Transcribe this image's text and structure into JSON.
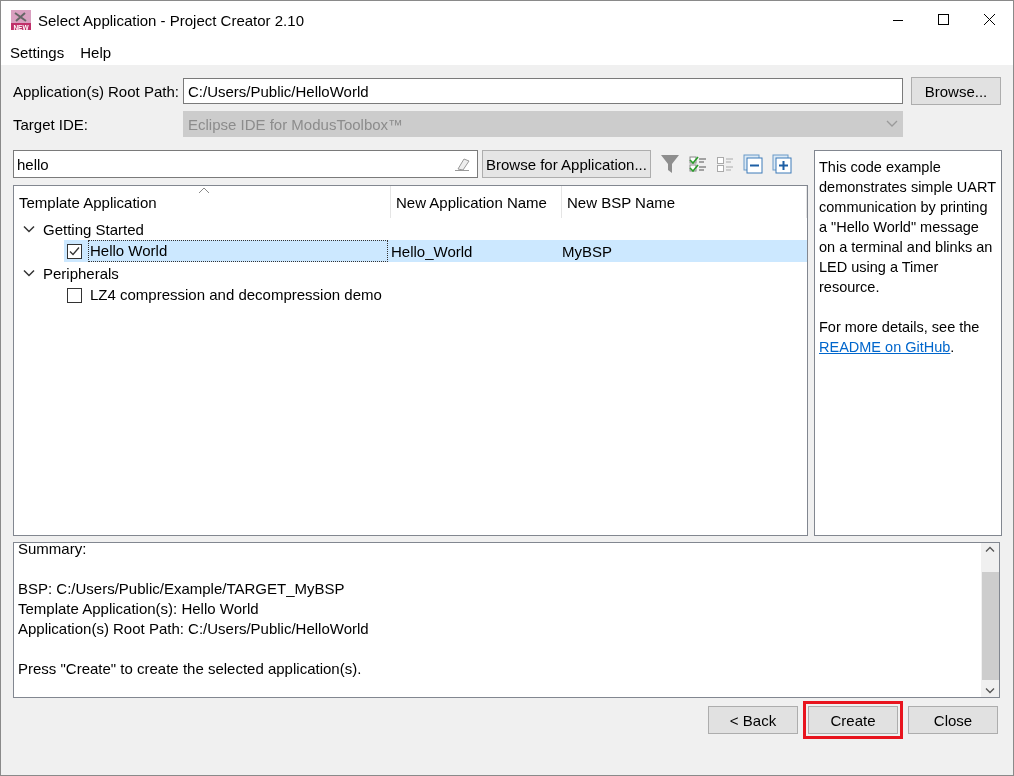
{
  "window": {
    "title": "Select Application - Project Creator 2.10",
    "icon_label": "NEW"
  },
  "menu": [
    {
      "label": "Settings"
    },
    {
      "label": "Help"
    }
  ],
  "root_path": {
    "label": "Application(s) Root Path:",
    "value": "C:/Users/Public/HelloWorld",
    "button": "Browse..."
  },
  "target_ide": {
    "label": "Target IDE:",
    "value": "Eclipse IDE for ModusToolbox™",
    "disabled": true
  },
  "search": {
    "value": "hello",
    "button": "Browse for Application..."
  },
  "tree": {
    "columns": [
      "Template Application",
      "New Application Name",
      "New BSP Name"
    ],
    "groups": [
      {
        "label": "Getting Started",
        "expanded": true,
        "children": [
          {
            "label": "Hello World",
            "app_name": "Hello_World",
            "bsp_name": "MyBSP",
            "checked": true,
            "selected": true
          }
        ]
      },
      {
        "label": "Peripherals",
        "expanded": true,
        "children": [
          {
            "label": "LZ4 compression and decompression demo",
            "checked": false,
            "selected": false
          }
        ]
      }
    ]
  },
  "description": {
    "text": "This code example demonstrates simple UART communication by printing a \"Hello World\" message on a terminal and blinks an LED using a Timer resource.",
    "more": "For more details, see the",
    "link": "README on GitHub",
    "after": "."
  },
  "summary": [
    [
      "Summary:"
    ],
    [
      "BSP: C:/Users/Public/Example/TARGET_MyBSP",
      "Template Application(s): Hello World",
      "Application(s) Root Path: C:/Users/Public/HelloWorld"
    ],
    [
      "Press \"Create\" to create the selected application(s)."
    ]
  ],
  "buttons": [
    {
      "label": "< Back",
      "highlighted": false
    },
    {
      "label": "Create",
      "highlighted": true
    },
    {
      "label": "Close",
      "highlighted": false
    }
  ]
}
